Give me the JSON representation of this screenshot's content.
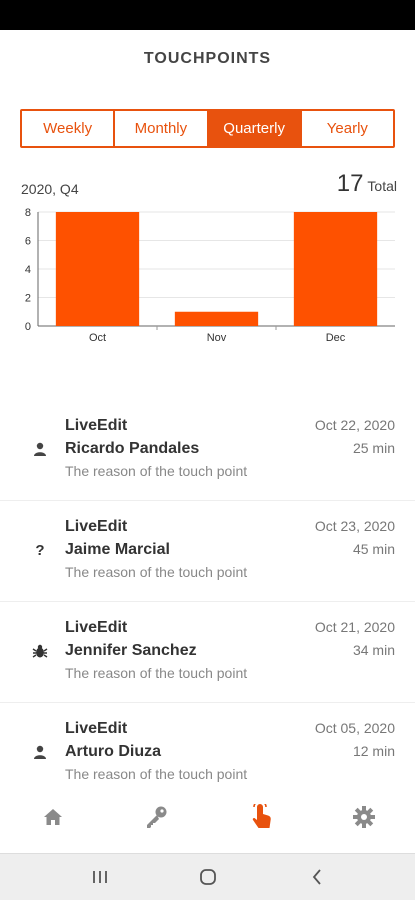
{
  "header": {
    "title": "TOUCHPOINTS"
  },
  "segments": [
    {
      "label": "Weekly",
      "active": false
    },
    {
      "label": "Monthly",
      "active": false
    },
    {
      "label": "Quarterly",
      "active": true
    },
    {
      "label": "Yearly",
      "active": false
    }
  ],
  "summary": {
    "period": "2020, Q4",
    "total_value": "17",
    "total_label": "Total"
  },
  "chart_data": {
    "type": "bar",
    "categories": [
      "Oct",
      "Nov",
      "Dec"
    ],
    "values": [
      8,
      1,
      8
    ],
    "ylim": [
      0,
      8
    ],
    "yticks": [
      0,
      2,
      4,
      6,
      8
    ],
    "grid": true,
    "color": "#fe5100"
  },
  "touchpoints": [
    {
      "app": "LiveEdit",
      "person": "Ricardo Pandales",
      "reason": "The reason of the touch point",
      "date": "Oct 22, 2020",
      "duration": "25 min",
      "icon": "person-icon"
    },
    {
      "app": "LiveEdit",
      "person": "Jaime Marcial",
      "reason": "The reason of the touch point",
      "date": "Oct 23, 2020",
      "duration": "45 min",
      "icon": "question-icon"
    },
    {
      "app": "LiveEdit",
      "person": "Jennifer Sanchez",
      "reason": "The reason of the touch point",
      "date": "Oct 21, 2020",
      "duration": "34 min",
      "icon": "bug-icon"
    },
    {
      "app": "LiveEdit",
      "person": "Arturo Diuza",
      "reason": "The reason of the touch point",
      "date": "Oct 05, 2020",
      "duration": "12 min",
      "icon": "person-icon"
    }
  ],
  "tabs": [
    {
      "icon": "home-icon",
      "active": false
    },
    {
      "icon": "key-icon",
      "active": false
    },
    {
      "icon": "touch-icon",
      "active": true
    },
    {
      "icon": "gear-icon",
      "active": false
    }
  ],
  "colors": {
    "accent": "#e8520e",
    "bar": "#fe5100",
    "inactive_icon": "#8a8a8a"
  }
}
